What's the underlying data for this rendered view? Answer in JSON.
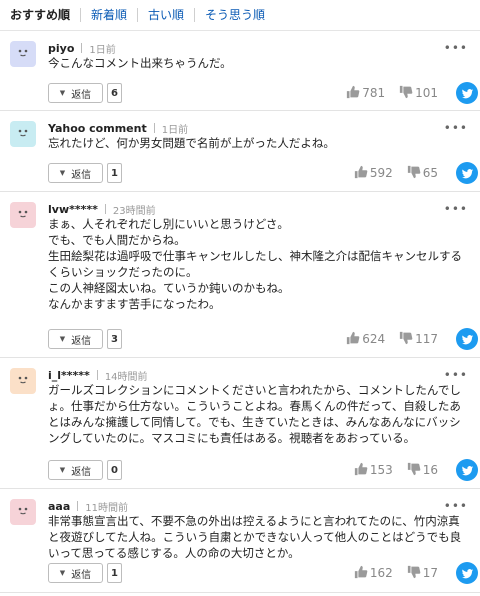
{
  "tabs": [
    {
      "label": "おすすめ順"
    },
    {
      "label": "新着順"
    },
    {
      "label": "古い順"
    },
    {
      "label": "そう思う順"
    }
  ],
  "reply_label": "返信",
  "more_label": "•••",
  "comments": [
    {
      "user": "piyo",
      "time": "1日前",
      "avatar_color": "#d6dcf7",
      "lines": [
        "今こんなコメント出来ちゃうんだ。"
      ],
      "replies": "6",
      "likes": "781",
      "dislikes": "101"
    },
    {
      "user": "Yahoo comment",
      "time": "1日前",
      "avatar_color": "#c8ecf2",
      "lines": [
        "忘れたけど、何か男女問題で名前が上がった人だよね。"
      ],
      "replies": "1",
      "likes": "592",
      "dislikes": "65"
    },
    {
      "user": "lvw*****",
      "time": "23時間前",
      "avatar_color": "#f6d3d8",
      "lines": [
        "まぁ、人それぞれだし別にいいと思うけどさ。",
        "でも、でも人間だからね。",
        "生田絵梨花は過呼吸で仕事キャンセルしたし、神木隆之介は配信キャンセルする",
        "くらいショックだったのに。",
        "この人神経図太いね。ていうか鈍いのかもね。",
        "なんかますます苦手になったわ。"
      ],
      "replies": "3",
      "likes": "624",
      "dislikes": "117"
    },
    {
      "user": "i_l*****",
      "time": "14時間前",
      "avatar_color": "#fbe0c8",
      "lines": [
        "ガールズコレクションにコメントくださいと言われたから、コメントしたんでし",
        "ょ。仕事だから仕方ない。こういうことよね。春馬くんの件だって、自殺したあ",
        "とはみんな擁護して同情して。でも、生きていたときは、みんなあんなにバッシ",
        "ングしていたのに。マスコミにも責任はある。視聴者をあおっている。"
      ],
      "replies": "0",
      "likes": "153",
      "dislikes": "16"
    },
    {
      "user": "aaa",
      "time": "11時間前",
      "avatar_color": "#f6d3d8",
      "lines": [
        "非常事態宣言出て、不要不急の外出は控えるようにと言われてたのに、竹内涼真",
        "と夜遊びしてた人ね。こういう自粛とかできない人って他人のことはどうでも良",
        "いって思ってる感じする。人の命の大切さとか。"
      ],
      "replies": "1",
      "likes": "162",
      "dislikes": "17"
    }
  ]
}
